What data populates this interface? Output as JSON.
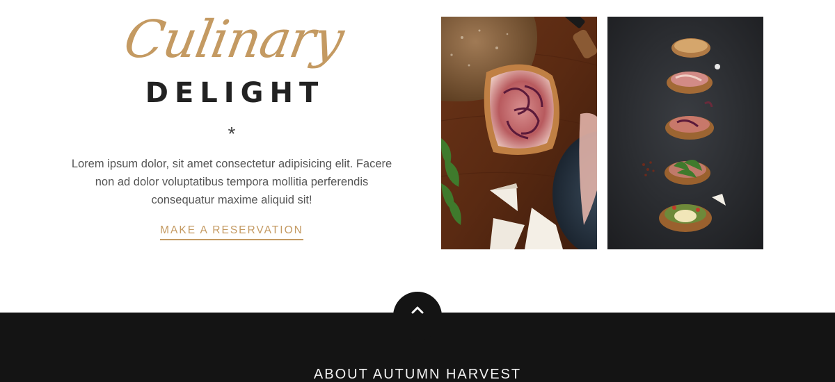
{
  "intro": {
    "script_title": "Culinary",
    "block_title": "DELIGHT",
    "separator": "*",
    "text": "Lorem ipsum dolor, sit amet consectetur adipisicing elit. Facere non ad dolor voluptatibus tempora mollitia perferendis consequatur maxime aliquid sit!",
    "reservation_label": "MAKE A RESERVATION"
  },
  "footer": {
    "back_to_top_icon": "chevron-up-icon",
    "heading": "ABOUT AUTUMN HARVEST"
  },
  "colors": {
    "accent": "#c49a62",
    "heading_dark": "#222222",
    "body_text": "#555555",
    "footer_bg": "#141414",
    "footer_text": "#f2f2f2"
  }
}
